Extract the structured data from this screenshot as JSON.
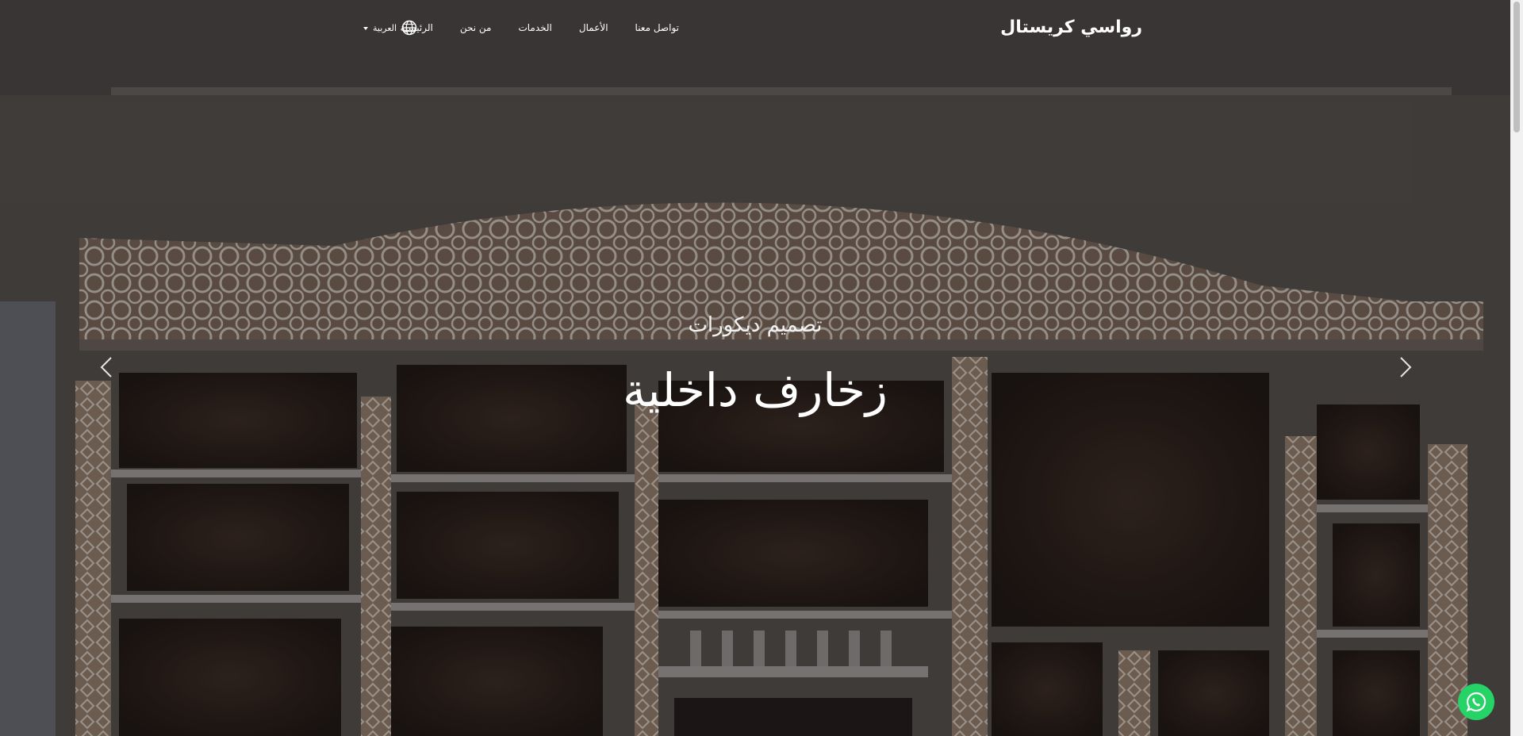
{
  "header": {
    "brand": "رواسي كريستال",
    "nav": [
      "الرئيسية",
      "من نحن",
      "الخدمات",
      "الأعمال",
      "تواصل معنا"
    ],
    "language": "العربية"
  },
  "hero": {
    "subtitle": "تصميم ديكورات",
    "title": "زخارف داخلية"
  },
  "icons": {
    "language": "globe-icon",
    "prev": "chevron-left-icon",
    "next": "chevron-right-icon",
    "whatsapp": "whatsapp-icon"
  },
  "colors": {
    "whatsapp": "#25d366",
    "text": "#ffffff"
  }
}
